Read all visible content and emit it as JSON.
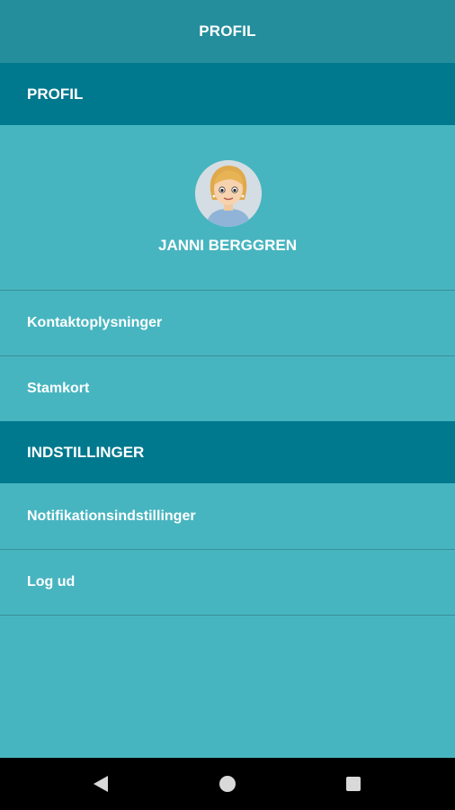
{
  "app_bar": {
    "title": "PROFIL"
  },
  "sections": {
    "profile_header": "PROFIL",
    "settings_header": "INDSTILLINGER"
  },
  "profile": {
    "name": "JANNI BERGGREN"
  },
  "menu": {
    "contact": "Kontaktoplysninger",
    "stamkort": "Stamkort",
    "notifications": "Notifikationsindstillinger",
    "logout": "Log ud"
  },
  "nav_icons": {
    "back": "back-triangle-icon",
    "home": "home-circle-icon",
    "recents": "recents-square-icon"
  },
  "colors": {
    "top_bar": "#258e9c",
    "section_header": "#00788d",
    "background": "#47b5c0",
    "nav_bar": "#000000"
  }
}
